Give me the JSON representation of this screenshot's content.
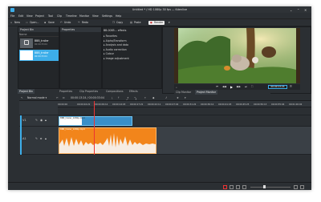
{
  "window": {
    "title": "Untitled * / HD 1080p 30 fps — Kdenlive",
    "controls": [
      "⌄",
      "⌃",
      "✕"
    ]
  },
  "menubar": [
    "File",
    "Edit",
    "View",
    "Project",
    "Tool",
    "Clip",
    "Timeline",
    "Monitor",
    "View",
    "Settings",
    "Help"
  ],
  "toolbar": {
    "new": "New",
    "open": "Open...",
    "save": "Save",
    "undo": "Undo",
    "redo": "Redo",
    "copy": "Copy",
    "paste": "Paste",
    "render": "Render",
    "menu_extra": "▾"
  },
  "project_bin": {
    "title": "Project Bin",
    "column": "Name",
    "clip1": "BBB_trailer",
    "clip1_sub": "00:00:33:04",
    "clip2": "BBB_trailer",
    "clip2_sub": "00:00:33:04"
  },
  "properties": {
    "title": "Properties",
    "clip_header": "BB-0085... effects",
    "effects": [
      "Favorites",
      "Alpha/Transform",
      "Analysis and data",
      "Audio correction",
      "Colour",
      "Image adjustment"
    ]
  },
  "left_tabs": [
    "Project Bin",
    "Properties",
    "Clip Properties",
    "Compositions",
    "Effects"
  ],
  "monitor": {
    "timecode": "00:00:13:24",
    "tabs": [
      "Clip Monitor",
      "Project Monitor"
    ]
  },
  "timeline_toolbar": {
    "mode": "Normal mode",
    "timecode": "00:00:13:24 / 00:00:33:04"
  },
  "ruler": [
    "00:00:00",
    "00:00:04:21",
    "00:00:09:12",
    "00:00:14:03",
    "00:00:17:21",
    "00:00:22:11",
    "00:00:27:02",
    "00:00:31:22",
    "00:00:36:12",
    "00:00:41:03",
    "00:00:45:23",
    "00:00:50:13",
    "00:00:55:04",
    "00:01:00:02",
    "00:01:04:15",
    "00:01:09:06"
  ],
  "tracks": {
    "v_label": "V1",
    "a_label": "A1",
    "video_clip": "BBB_trailer_1080p.mp4",
    "audio_clip": "BBB_trailer_1080p.mp4"
  },
  "colors": {
    "accent": "#3daee9",
    "audio": "#f2851b",
    "playhead": "#ee3333"
  }
}
